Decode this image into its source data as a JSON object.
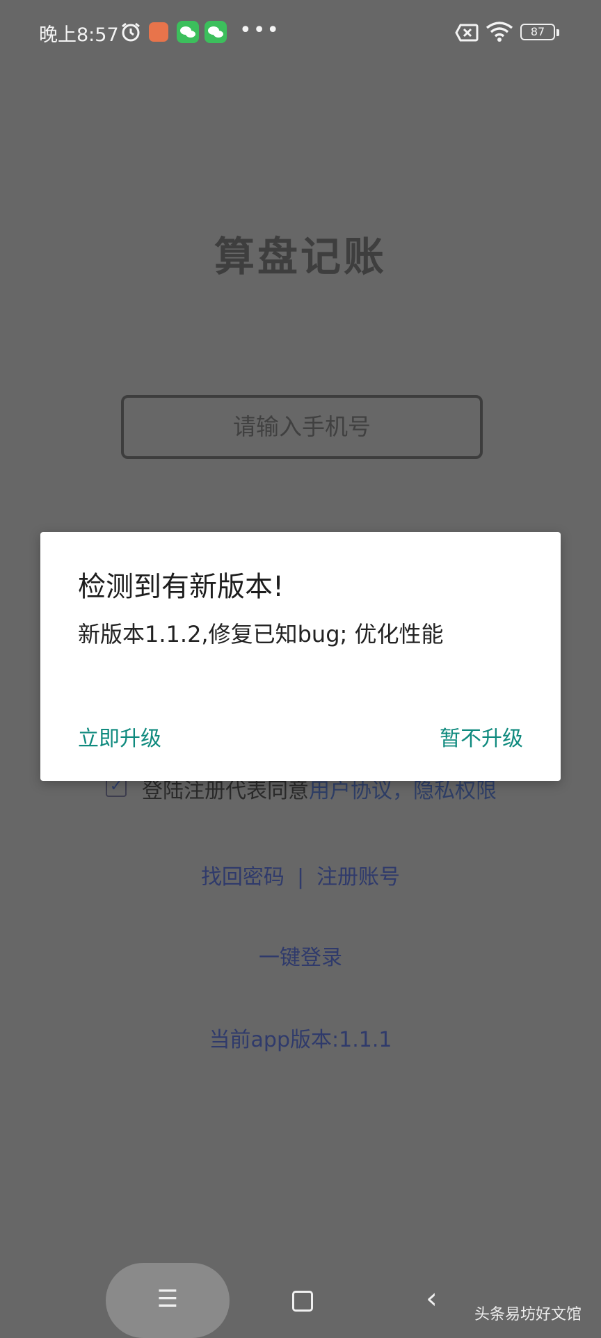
{
  "status_bar": {
    "time": "晚上8:57",
    "battery": "87",
    "icons": [
      "alarm-icon",
      "app-notification-icon",
      "wechat-icon",
      "wechat-icon",
      "more-icon",
      "no-sim-icon",
      "wifi-icon",
      "battery-icon"
    ]
  },
  "login": {
    "app_title": "算盘记账",
    "phone_placeholder": "请输入手机号",
    "agree_prefix": "登陆注册代表同意",
    "agree_link": "用户协议，隐私权限",
    "forgot_password": "找回密码",
    "separator": "|",
    "register": "注册账号",
    "one_click_login": "一键登录",
    "current_version": "当前app版本:1.1.1"
  },
  "dialog": {
    "title": "检测到有新版本!",
    "message": "新版本1.1.2,修复已知bug; 优化性能",
    "upgrade_now": "立即升级",
    "later": "暂不升级"
  },
  "watermark": "头条易坊好文馆",
  "colors": {
    "overlay_bg": "#676767",
    "dialog_bg": "#ffffff",
    "accent": "#0f8a7e",
    "link": "#2f3a6b"
  }
}
